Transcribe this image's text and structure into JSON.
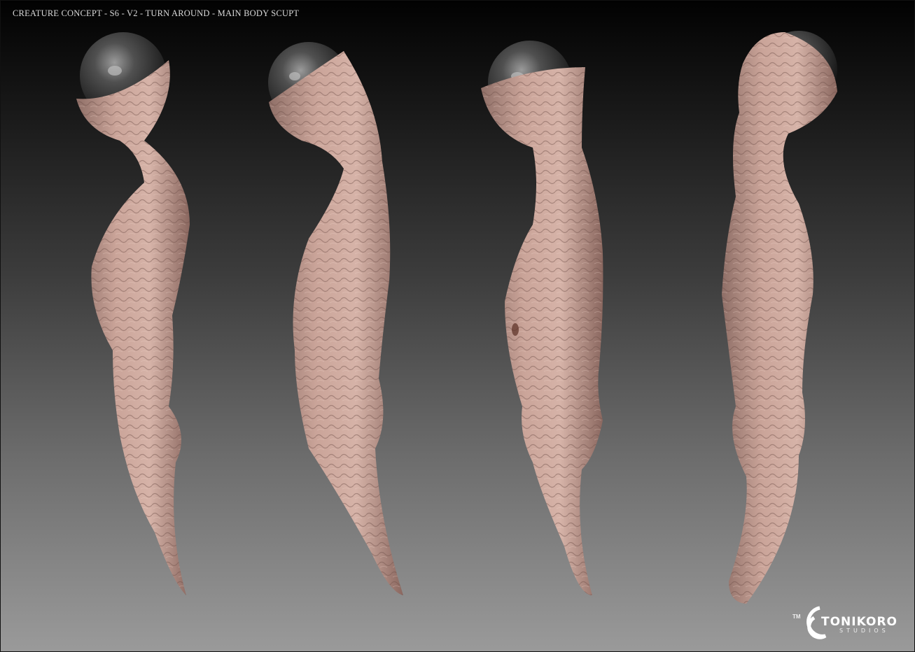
{
  "header": {
    "title": "CREATURE CONCEPT - S6 - V2 - TURN AROUND - MAIN BODY SCUPT"
  },
  "views": [
    {
      "name": "view-1"
    },
    {
      "name": "view-2"
    },
    {
      "name": "view-3"
    },
    {
      "name": "view-4"
    }
  ],
  "colors": {
    "skin": "#c9a196",
    "skin_shadow": "#8a6860",
    "eye": "#4a4a4a"
  },
  "logo": {
    "tm": "TM",
    "name": "TONIKORO",
    "subtitle": "STUDIOS"
  }
}
